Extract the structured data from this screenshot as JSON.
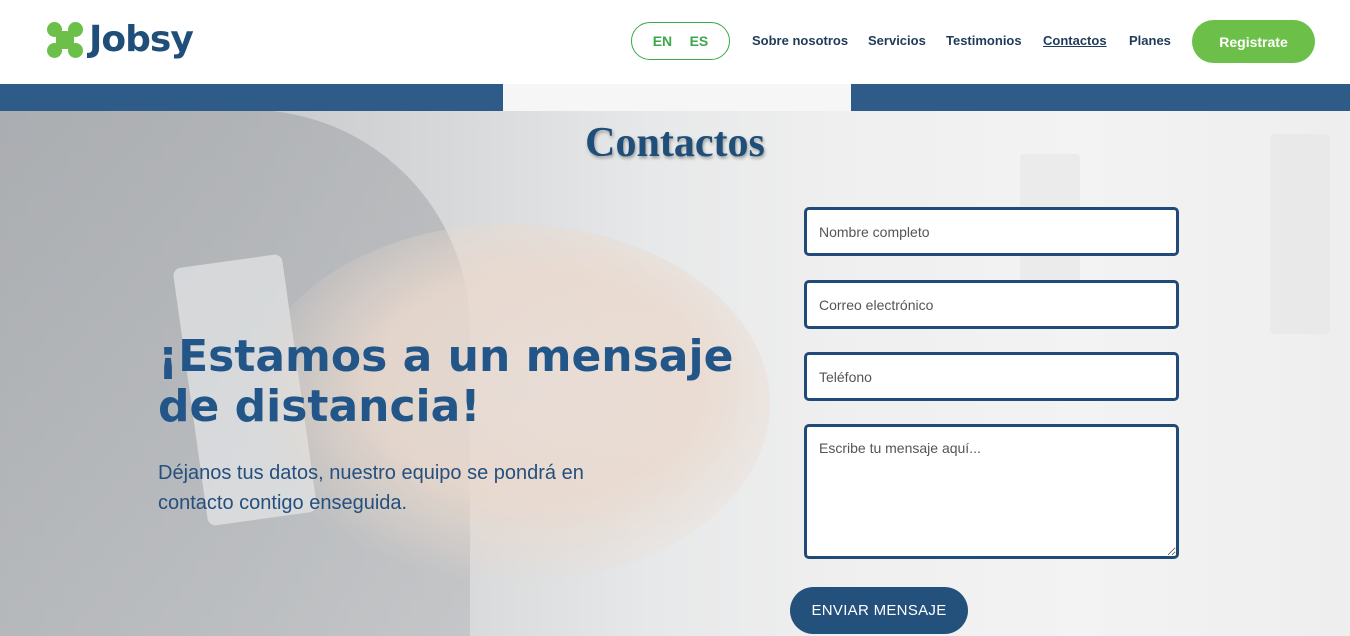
{
  "brand": {
    "name": "Jobsy",
    "green": "#6cc04a",
    "navy": "#1f4e79"
  },
  "header": {
    "lang": [
      "EN",
      "ES"
    ],
    "nav": [
      "Sobre nosotros",
      "Servicios",
      "Testimonios",
      "Contactos",
      "Planes"
    ],
    "active_nav": "Contactos",
    "register_label": "Registrate"
  },
  "hero": {
    "title": "Contactos",
    "headline": "¡Estamos a un mensaje de distancia!",
    "subtext": "Déjanos tus datos, nuestro equipo se pondrá en contacto contigo enseguida."
  },
  "form": {
    "name_placeholder": "Nombre completo",
    "email_placeholder": "Correo electrónico",
    "phone_placeholder": "Teléfono",
    "message_placeholder": "Escribe tu mensaje aquí...",
    "submit_label": "ENVIAR MENSAJE"
  }
}
